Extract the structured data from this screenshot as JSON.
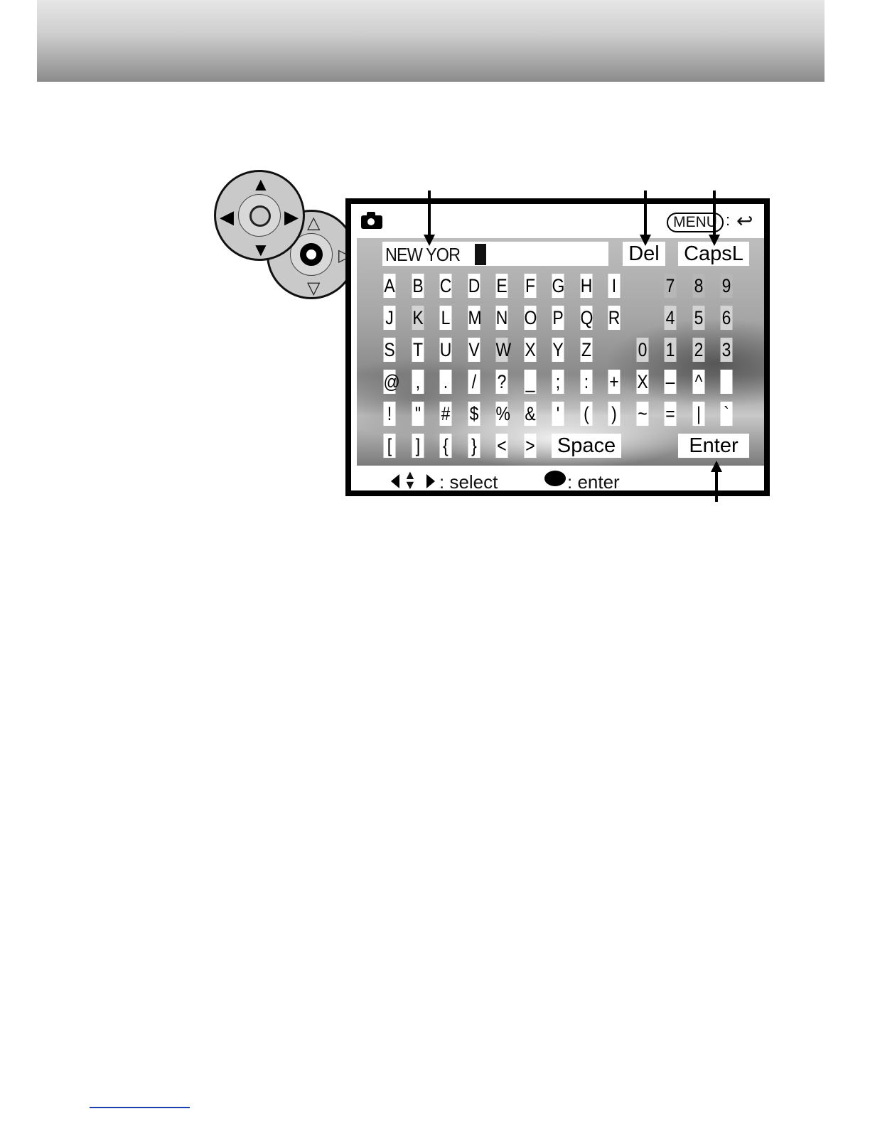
{
  "screen": {
    "menu_label": "MENU",
    "menu_separator": ":",
    "back_symbol": "↩",
    "text_value": "NEW YOR",
    "del_label": "Del",
    "capsl_label": "CapsL",
    "space_label": "Space",
    "enter_label": "Enter",
    "hint_select": ": select",
    "hint_enter": ":  enter"
  },
  "keyboard": {
    "row1": [
      "A",
      "B",
      "C",
      "D",
      "E",
      "F",
      "G",
      "H",
      "I",
      "7",
      "8",
      "9"
    ],
    "row2": [
      "J",
      "K",
      "L",
      "M",
      "N",
      "O",
      "P",
      "Q",
      "R",
      "4",
      "5",
      "6"
    ],
    "row3": [
      "S",
      "T",
      "U",
      "V",
      "W",
      "X",
      "Y",
      "Z",
      "0",
      "1",
      "2",
      "3"
    ],
    "row4": [
      "@",
      ",",
      ".",
      "/",
      "?",
      "_",
      ";",
      ":",
      "+",
      "X",
      "–",
      "^",
      ""
    ],
    "row5": [
      "!",
      "\"",
      "#",
      "$",
      "%",
      "&",
      "'",
      "(",
      ")",
      "~",
      "=",
      "|",
      "`"
    ],
    "row6": [
      "[",
      "]",
      "{",
      "}",
      "<",
      ">"
    ]
  },
  "controller": {
    "up": "▲",
    "down": "▼",
    "left": "◀",
    "right": "▶",
    "hollow_up": "△",
    "hollow_down": "▽",
    "hollow_right": "▷"
  }
}
